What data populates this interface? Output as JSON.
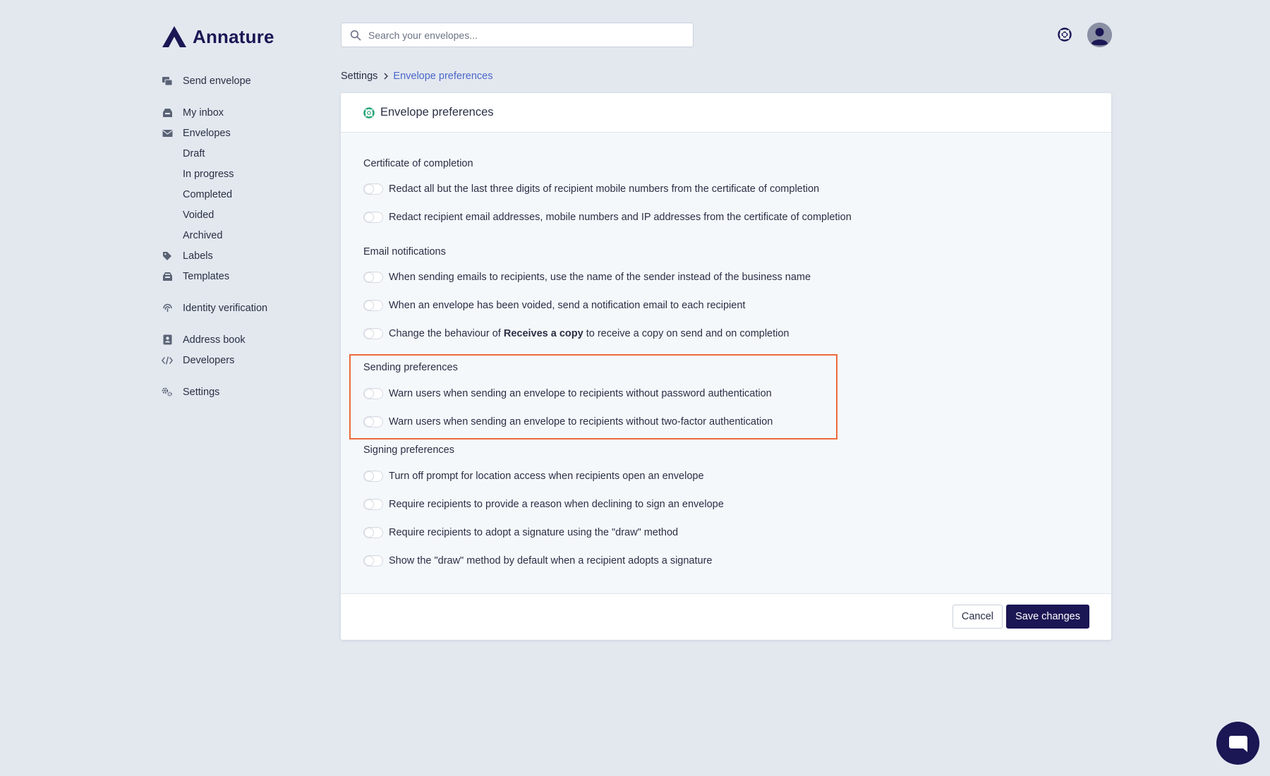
{
  "brand": {
    "name": "Annature",
    "color": "#1b1654"
  },
  "search": {
    "placeholder": "Search your envelopes...",
    "value": ""
  },
  "sidebar": {
    "items": [
      {
        "label": "Send envelope",
        "icon": "send-envelope-icon"
      },
      {
        "label": "My inbox",
        "icon": "inbox-icon"
      },
      {
        "label": "Envelopes",
        "icon": "envelope-icon"
      },
      {
        "label": "Draft"
      },
      {
        "label": "In progress"
      },
      {
        "label": "Completed"
      },
      {
        "label": "Voided"
      },
      {
        "label": "Archived"
      },
      {
        "label": "Labels",
        "icon": "tag-icon"
      },
      {
        "label": "Templates",
        "icon": "templates-icon"
      },
      {
        "label": "Identity verification",
        "icon": "fingerprint-icon"
      },
      {
        "label": "Address book",
        "icon": "address-book-icon"
      },
      {
        "label": "Developers",
        "icon": "code-icon"
      },
      {
        "label": "Settings",
        "icon": "gears-icon"
      }
    ]
  },
  "breadcrumb": {
    "root": "Settings",
    "current": "Envelope preferences",
    "current_color": "#4a67c9"
  },
  "card": {
    "title": "Envelope preferences",
    "sections": [
      {
        "title": "Certificate of completion",
        "options": [
          {
            "label": "Redact all but the last three digits of recipient mobile numbers from the certificate of completion",
            "enabled": false
          },
          {
            "label": "Redact recipient email addresses, mobile numbers and IP addresses from the certificate of completion",
            "enabled": false
          }
        ]
      },
      {
        "title": "Email notifications",
        "options": [
          {
            "label": "When sending emails to recipients, use the name of the sender instead of the business name",
            "enabled": false
          },
          {
            "label": "When an envelope has been voided, send a notification email to each recipient",
            "enabled": false
          },
          {
            "label_pre": "Change the behaviour of ",
            "label_bold": "Receives a copy",
            "label_post": " to receive a copy on send and on completion",
            "enabled": false
          }
        ]
      },
      {
        "title": "Sending preferences",
        "options": [
          {
            "label": "Warn users when sending an envelope to recipients without password authentication",
            "enabled": false
          },
          {
            "label": "Warn users when sending an envelope to recipients without two-factor authentication",
            "enabled": false
          }
        ]
      },
      {
        "title": "Signing preferences",
        "options": [
          {
            "label": "Turn off prompt for location access when recipients open an envelope",
            "enabled": false
          },
          {
            "label": "Require recipients to provide a reason when declining to sign an envelope",
            "enabled": false
          },
          {
            "label": "Require recipients to adopt a signature using the \"draw\" method",
            "enabled": false
          },
          {
            "label": "Show the \"draw\" method by default when a recipient adopts a signature",
            "enabled": false
          }
        ]
      }
    ],
    "highlight_color": "#ec6b3c"
  },
  "footer": {
    "cancel_label": "Cancel",
    "save_label": "Save changes"
  }
}
